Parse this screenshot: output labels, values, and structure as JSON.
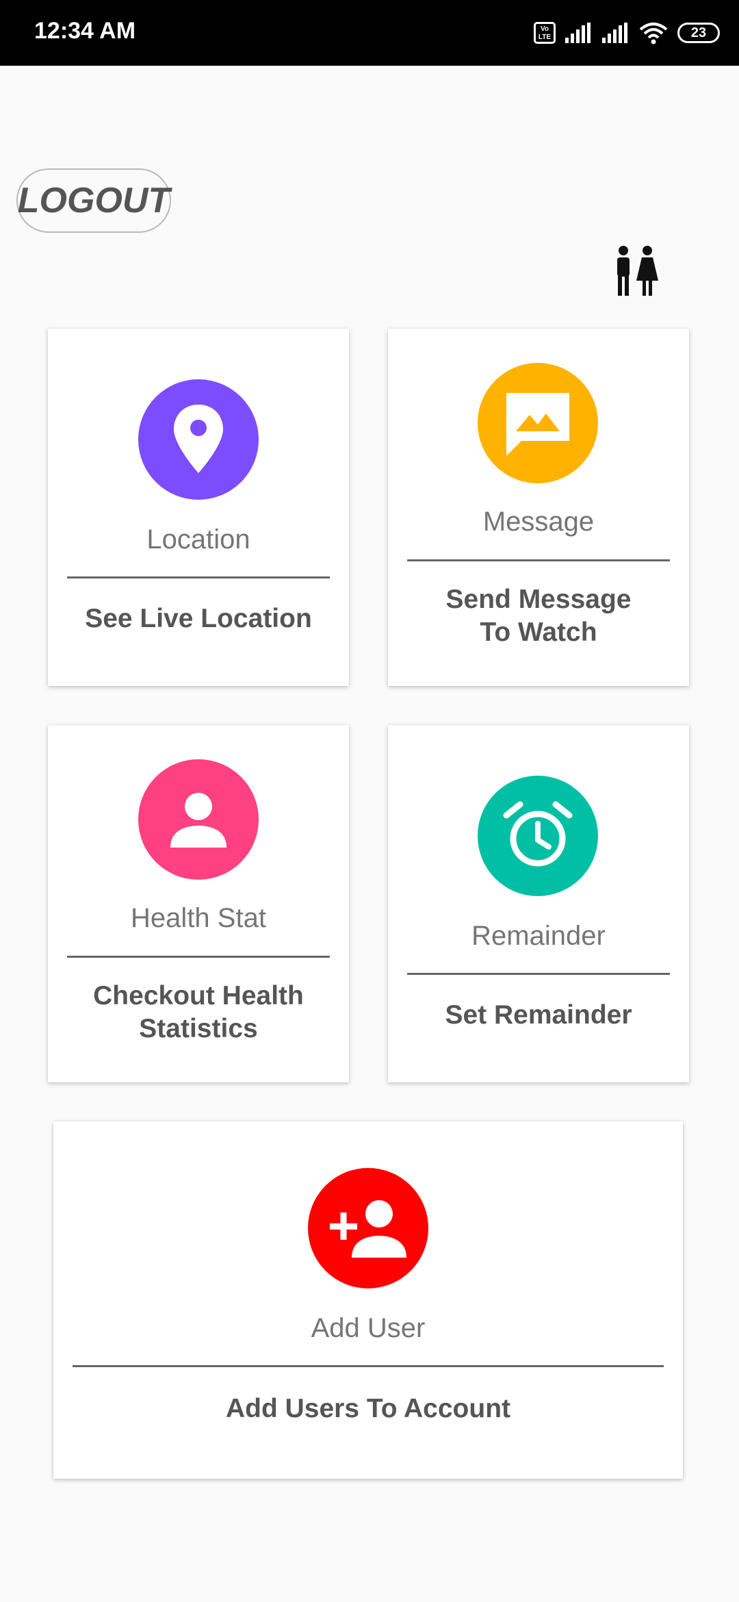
{
  "status_bar": {
    "time": "12:34 AM",
    "volte_label": "Vo LTE",
    "battery": "23"
  },
  "header": {
    "logout_label": "LOGOUT"
  },
  "cards": [
    {
      "title": "Location",
      "description": "See Live Location",
      "icon": "location-pin-icon",
      "color": "#7c4dff"
    },
    {
      "title": "Message",
      "description_line1": "Send Message",
      "description_line2": "To Watch",
      "icon": "message-image-icon",
      "color": "#ffb300"
    },
    {
      "title": "Health Stat",
      "description_line1": "Checkout Health",
      "description_line2": "Statistics",
      "icon": "person-icon",
      "color": "#ff4081"
    },
    {
      "title": "Remainder",
      "description": "Set Remainder",
      "icon": "alarm-clock-icon",
      "color": "#00bfa5"
    },
    {
      "title": "Add User",
      "description": "Add Users To Account",
      "icon": "add-user-icon",
      "color": "#ff0000"
    }
  ]
}
